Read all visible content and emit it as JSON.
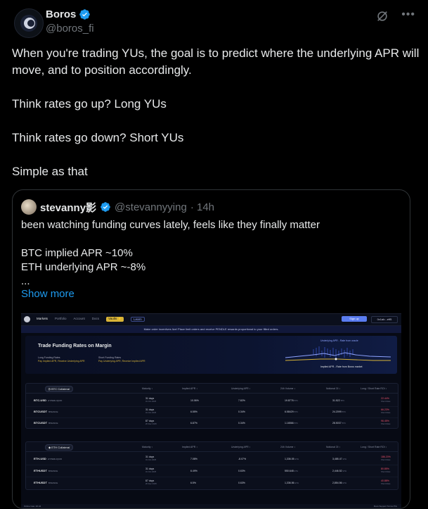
{
  "author": {
    "display_name": "Boros",
    "handle": "@boros_fi"
  },
  "post": {
    "paragraphs": [
      "When you're trading YUs, the goal is to predict where the underlying APR will move, and to position accordingly.",
      "Think rates go up? Long YUs",
      "Think rates go down? Short YUs",
      "Simple as that"
    ]
  },
  "quote": {
    "display_name": "stevanny影",
    "handle": "@stevannyying",
    "time": "· 14h",
    "line1": "been watching funding curves lately, feels like they finally matter",
    "line2": "BTC implied APR ~10%",
    "line3": "ETH underlying APR ~-8%",
    "line4": "...",
    "show_more": "Show more"
  },
  "screenshot": {
    "nav": [
      "Markets",
      "Portfolio",
      "Account",
      "Docs",
      "Vaults ⚡",
      "Learn"
    ],
    "signup": "Sign up",
    "wallet": "0x1ab...eff5",
    "banner": "Make order incentives live! Place limit orders and receive PENDLE rewards proportional to your filled orders.",
    "hero_title": "Trade Funding Rates on Margin",
    "long_title": "Long Funding Rates",
    "long_desc_a": "Pay Implied APR,",
    "long_desc_b": "Receive Underlying APR",
    "short_title": "Short Funding Rates",
    "short_desc_a": "Pay Underlying APR,",
    "short_desc_b": "Receive Implied APR",
    "chart_top": "Underlying APR - Rate from oracle",
    "chart_bottom": "Implied APR - Rate from Boros market",
    "columns": [
      "Maturity ↕",
      "Implied APR ↕",
      "Underlying APR ↕",
      "24h Volume ↕",
      "Notional OI ↕",
      "Long / Short Rate ROI ↕"
    ],
    "btc_title": "BTC Collateral",
    "eth_title": "ETH Collateral",
    "btc_rows": [
      {
        "market": "BTC-USD",
        "exchange": "HYPERLIQUID",
        "days": "31 days",
        "date": "31 Oct 2025",
        "implied": "10.06%",
        "underlying": "7.82%",
        "volume": "19.8776",
        "vol_unit": "BTC",
        "oi": "31.522",
        "oi_unit": "BTC",
        "roi": "22.44%",
        "roi_sub": "Short Rate"
      },
      {
        "market": "BTCUSDT",
        "exchange": "BINANCE",
        "days": "31 days",
        "date": "31 Oct 2025",
        "implied": "6.55%",
        "underlying": "0.34%",
        "volume": "6.58429",
        "vol_unit": "BTC",
        "oi": "24.2099",
        "oi_unit": "BTC",
        "roi": "66.23%",
        "roi_sub": "Short Rate"
      },
      {
        "market": "BTCUSDT",
        "exchange": "BINANCE",
        "days": "87 days",
        "date": "26 Dec 2025",
        "implied": "6.87%",
        "underlying": "0.34%",
        "volume": "1.16566",
        "vol_unit": "BTC",
        "oi": "28.5037",
        "oi_unit": "BTC",
        "roi": "96.45%",
        "roi_sub": "Short Rate"
      }
    ],
    "eth_rows": [
      {
        "market": "ETH-USD",
        "exchange": "HYPERLIQUID",
        "days": "31 days",
        "date": "31 Oct 2025",
        "implied": "7.08%",
        "underlying": "-8.07%",
        "volume": "1,336.05",
        "vol_unit": "ETH",
        "oi": "3,485.47",
        "oi_unit": "ETH",
        "roi": "186.20%",
        "roi_sub": "Short Rate"
      },
      {
        "market": "ETHUSDT",
        "exchange": "BINANCE",
        "days": "31 days",
        "date": "31 Oct 2025",
        "implied": "6.49%",
        "underlying": "0.63%",
        "volume": "550.648",
        "vol_unit": "ETH",
        "oi": "2,446.52",
        "oi_unit": "ETH",
        "roi": "80.85%",
        "roi_sub": "Short Rate"
      },
      {
        "market": "ETHUSDT",
        "exchange": "BINANCE",
        "days": "87 days",
        "date": "26 Dec 2025",
        "implied": "6.5%",
        "underlying": "0.63%",
        "volume": "1,336.56",
        "vol_unit": "ETH",
        "oi": "2,854.56",
        "oi_unit": "ETH",
        "roi": "40.88%",
        "roi_sub": "Short Rate"
      }
    ],
    "footer_left": "Online  Gas: 26.44",
    "footer_right": "Docs   Support   Terms   Priv"
  },
  "colors": {
    "background": "#000000",
    "link": "#1d9bf0",
    "verified": "#1d9bf0",
    "accent_gold": "#d9b437",
    "short_red": "#f0536b"
  }
}
